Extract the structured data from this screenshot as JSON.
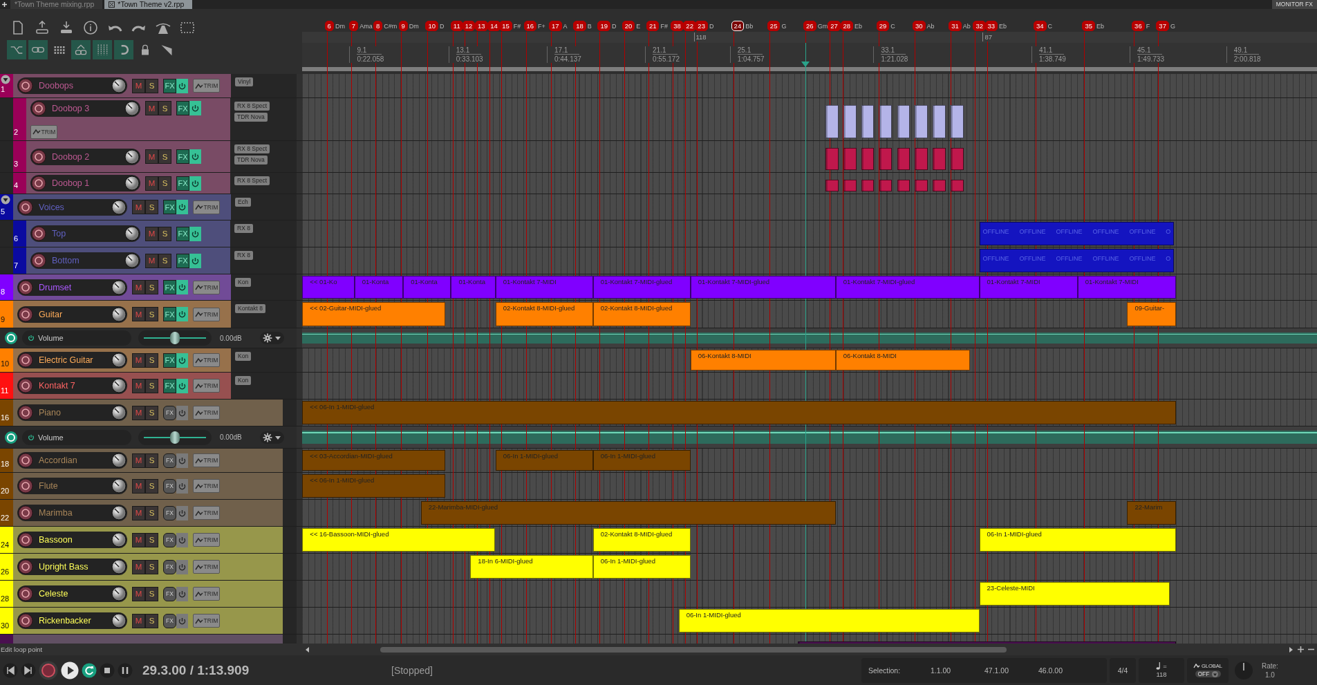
{
  "tabs": [
    {
      "label": "*Town Theme mixing.rpp",
      "selected": false
    },
    {
      "label": "*Town Theme v2.rpp",
      "selected": true
    }
  ],
  "monitor_fx": "MONITOR FX",
  "toolbar": [
    [
      {
        "kind": "new-file"
      },
      {
        "kind": "save-up"
      },
      {
        "kind": "save-down"
      },
      {
        "kind": "info"
      },
      {
        "kind": "undo"
      },
      {
        "kind": "redo"
      },
      {
        "kind": "metronome"
      },
      {
        "kind": "marquee"
      }
    ],
    [
      {
        "kind": "crossfade",
        "on": true
      },
      {
        "kind": "link",
        "on": true
      },
      {
        "kind": "grid",
        "on": false
      },
      {
        "kind": "env-link",
        "on": true
      },
      {
        "kind": "grid-lines",
        "on": true
      },
      {
        "kind": "snap",
        "on": true
      },
      {
        "kind": "lock",
        "on": false
      },
      {
        "kind": "ruler",
        "on": false
      }
    ]
  ],
  "markers": [
    {
      "number": "6",
      "label": "Dm",
      "selected": false
    },
    {
      "number": "7",
      "label": "Ama",
      "selected": false
    },
    {
      "number": "8",
      "label": "C#m",
      "selected": false
    },
    {
      "number": "9",
      "label": "Dm",
      "selected": false
    },
    {
      "number": "10",
      "label": "D",
      "selected": false
    },
    {
      "number": "11",
      "selected": false
    },
    {
      "number": "12",
      "selected": false
    },
    {
      "number": "13",
      "selected": false
    },
    {
      "number": "14",
      "selected": false
    },
    {
      "number": "15",
      "label": "F#",
      "selected": false
    },
    {
      "number": "16",
      "label": "F+",
      "selected": false
    },
    {
      "number": "17",
      "label": "A",
      "selected": false
    },
    {
      "number": "18",
      "label": "B",
      "selected": false
    },
    {
      "number": "19",
      "label": "D",
      "selected": false
    },
    {
      "number": "20",
      "label": "E",
      "selected": false
    },
    {
      "number": "21",
      "label": "F#",
      "selected": false
    },
    {
      "number": "38",
      "selected": false
    },
    {
      "number": "22",
      "selected": false
    },
    {
      "number": "23",
      "label": "D",
      "selected": false
    },
    {
      "number": "24",
      "label": "Bb",
      "selected": true
    },
    {
      "number": "25",
      "label": "G",
      "selected": false
    },
    {
      "number": "26",
      "label": "Gm",
      "selected": false
    },
    {
      "number": "27",
      "selected": false
    },
    {
      "number": "28",
      "label": "Eb",
      "selected": false
    },
    {
      "number": "29",
      "label": "C",
      "selected": false
    },
    {
      "number": "30",
      "label": "Ab",
      "selected": false
    },
    {
      "number": "31",
      "label": "Ab",
      "selected": false
    },
    {
      "number": "32",
      "selected": false
    },
    {
      "number": "33",
      "label": "Eb",
      "selected": false
    },
    {
      "number": "34",
      "label": "C",
      "selected": false
    },
    {
      "number": "35",
      "label": "Eb",
      "selected": false
    },
    {
      "number": "36",
      "label": "F",
      "selected": false
    },
    {
      "number": "37",
      "label": "G",
      "selected": false
    }
  ],
  "tempo_markers": [
    "118",
    "87"
  ],
  "ruler": [
    {
      "bar": "9.1",
      "time": "0:22.058"
    },
    {
      "bar": "13.1",
      "time": "0:33.103"
    },
    {
      "bar": "17.1",
      "time": "0:44.137"
    },
    {
      "bar": "21.1",
      "time": "0:55.172"
    },
    {
      "bar": "25.1",
      "time": "1:04.757"
    },
    {
      "bar": "33.1",
      "time": "1:21.028"
    },
    {
      "bar": "41.1",
      "time": "1:38.749"
    },
    {
      "bar": "45.1",
      "time": "1:49.733"
    },
    {
      "bar": "49.1",
      "time": "2:00.818"
    }
  ],
  "tracks": [
    {
      "kind": "track",
      "number": "1",
      "name": "Doobops",
      "color": "#9a0058",
      "expanded": true,
      "mute_label": "M",
      "solo_label": "S",
      "fx_label": "FX",
      "fx_on": true,
      "trim_label": "TRIM",
      "plugins": [
        "Vinyl"
      ],
      "children": [
        {
          "kind": "track",
          "number": "2",
          "name": "Doobop 3",
          "color": "#9a0058",
          "mute_label": "M",
          "solo_label": "S",
          "fx_label": "FX",
          "fx_on": true,
          "trim_label": "TRIM",
          "plugins": [
            "RX 8 Spect",
            "TDR Nova"
          ],
          "clips": [
            {
              "kind": "audio",
              "color": "#b4b4e8"
            },
            {
              "kind": "audio",
              "color": "#b4b4e8"
            },
            {
              "kind": "audio",
              "color": "#b4b4e8"
            },
            {
              "kind": "audio",
              "color": "#b4b4e8"
            },
            {
              "kind": "audio",
              "color": "#b4b4e8"
            },
            {
              "kind": "audio",
              "color": "#b4b4e8"
            },
            {
              "kind": "audio",
              "color": "#b4b4e8"
            },
            {
              "kind": "audio",
              "color": "#b4b4e8"
            }
          ]
        },
        {
          "kind": "track",
          "number": "3",
          "name": "Doobop 2",
          "color": "#9a0058",
          "mute_label": "M",
          "solo_label": "S",
          "fx_label": "FX",
          "fx_on": true,
          "plugins": [
            "RX 8 Spect",
            "TDR Nova"
          ],
          "clips": [
            {
              "kind": "audio",
              "color": "#c0184c"
            },
            {
              "kind": "audio",
              "color": "#c0184c"
            },
            {
              "kind": "audio",
              "color": "#c0184c"
            },
            {
              "kind": "audio",
              "color": "#c0184c"
            },
            {
              "kind": "audio",
              "color": "#c0184c"
            },
            {
              "kind": "audio",
              "color": "#c0184c"
            },
            {
              "kind": "audio",
              "color": "#c0184c"
            },
            {
              "kind": "audio",
              "color": "#c0184c"
            }
          ]
        },
        {
          "kind": "track",
          "number": "4",
          "name": "Doobop 1",
          "color": "#9a0058",
          "mute_label": "M",
          "solo_label": "S",
          "fx_label": "FX",
          "fx_on": true,
          "plugins": [
            "RX 8 Spect"
          ],
          "clips": [
            {
              "kind": "audio",
              "color": "#c0184c"
            },
            {
              "kind": "audio",
              "color": "#c0184c"
            },
            {
              "kind": "audio",
              "color": "#c0184c"
            },
            {
              "kind": "audio",
              "color": "#c0184c"
            },
            {
              "kind": "audio",
              "color": "#c0184c"
            },
            {
              "kind": "audio",
              "color": "#c0184c"
            },
            {
              "kind": "audio",
              "color": "#c0184c"
            },
            {
              "kind": "audio",
              "color": "#c0184c"
            }
          ]
        }
      ]
    },
    {
      "kind": "track",
      "number": "5",
      "name": "Voices",
      "color": "#0a0aa0",
      "expanded": true,
      "mute_label": "M",
      "solo_label": "S",
      "fx_label": "FX",
      "fx_on": true,
      "trim_label": "TRIM",
      "plugins": [
        "Ech"
      ],
      "children": [
        {
          "kind": "track",
          "number": "6",
          "name": "Top",
          "color": "#0a0aa0",
          "mute_label": "M",
          "solo_label": "S",
          "fx_label": "FX",
          "fx_on": true,
          "plugins": [
            "RX 8"
          ],
          "clips": [
            {
              "kind": "offline",
              "labels": [
                "OFFLINE",
                "OFFLINE",
                "OFFLINE",
                "OFFLINE",
                "OFFLINE",
                "O"
              ]
            }
          ]
        },
        {
          "kind": "track",
          "number": "7",
          "name": "Bottom",
          "color": "#0a0aa0",
          "mute_label": "M",
          "solo_label": "S",
          "fx_label": "FX",
          "fx_on": true,
          "plugins": [
            "RX 8"
          ],
          "clips": [
            {
              "kind": "offline",
              "labels": [
                "OFFLINE",
                "OFFLINE",
                "OFFLINE",
                "OFFLINE",
                "OFFLINE",
                "O"
              ]
            }
          ]
        }
      ]
    },
    {
      "kind": "track",
      "number": "8",
      "name": "Drumset",
      "color": "#8000ff",
      "mute_label": "M",
      "solo_label": "S",
      "fx_label": "FX",
      "fx_on": true,
      "trim_label": "TRIM",
      "plugins": [
        "Kon"
      ],
      "clips": [
        {
          "kind": "midi",
          "label": "<< 01-Ko"
        },
        {
          "kind": "midi",
          "label": "01-Konta"
        },
        {
          "kind": "midi",
          "label": "01-Konta"
        },
        {
          "kind": "midi",
          "label": "01-Konta"
        },
        {
          "kind": "midi",
          "label": "01-Kontakt 7-MIDI"
        },
        {
          "kind": "midi",
          "label": "01-Kontakt 7-MIDI-glued"
        },
        {
          "kind": "midi",
          "label": "01-Kontakt 7-MIDI-glued"
        },
        {
          "kind": "midi",
          "label": "01-Kontakt 7-MIDI-glued"
        },
        {
          "kind": "midi",
          "label": "01-Kontakt 7-MIDI"
        },
        {
          "kind": "midi",
          "label": "01-Kontakt 7-MIDI"
        }
      ]
    },
    {
      "kind": "track",
      "number": "9",
      "name": "Guitar",
      "color": "#ff8000",
      "mute_label": "M",
      "solo_label": "S",
      "fx_label": "FX",
      "fx_on": true,
      "trim_label": "TRIM",
      "plugins": [
        "Kontakt 8"
      ],
      "clips": [
        {
          "kind": "midi",
          "label": "<< 02-Guitar-MIDI-glued"
        },
        {
          "kind": "midi",
          "label": "02-Kontakt 8-MIDI-glued"
        },
        {
          "kind": "midi",
          "label": "02-Kontakt 8-MIDI-glued"
        },
        {
          "kind": "midi",
          "label": "09-Guitar-"
        }
      ]
    },
    {
      "kind": "envelope",
      "name": "Volume",
      "value": "0.00dB",
      "level": 0.5
    },
    {
      "kind": "track",
      "number": "10",
      "name": "Electric Guitar",
      "color": "#ff8000",
      "mute_label": "M",
      "solo_label": "S",
      "fx_label": "FX",
      "fx_on": true,
      "trim_label": "TRIM",
      "plugins": [
        "Kon"
      ],
      "clips": [
        {
          "kind": "midi",
          "label": "06-Kontakt 8-MIDI"
        },
        {
          "kind": "midi",
          "label": "06-Kontakt 8-MIDI"
        }
      ]
    },
    {
      "kind": "track",
      "number": "11",
      "name": "Kontakt 7",
      "color": "#ff1010",
      "mute_label": "M",
      "solo_label": "S",
      "fx_label": "FX",
      "fx_on": true,
      "trim_label": "TRIM",
      "plugins": [
        "Kon"
      ]
    },
    {
      "kind": "track",
      "number": "16",
      "name": "Piano",
      "color": "#7a4500",
      "mute_label": "M",
      "solo_label": "S",
      "fx_label": "FX",
      "fx_on": false,
      "trim_label": "TRIM",
      "clips": [
        {
          "kind": "midi",
          "label": "<< 06-In 1-MIDI-glued"
        }
      ]
    },
    {
      "kind": "envelope",
      "name": "Volume",
      "value": "0.00dB",
      "level": 0.5
    },
    {
      "kind": "track",
      "number": "18",
      "name": "Accordian",
      "color": "#7a4500",
      "mute_label": "M",
      "solo_label": "S",
      "fx_label": "FX",
      "fx_on": false,
      "trim_label": "TRIM",
      "clips": [
        {
          "kind": "midi",
          "label": "<< 03-Accordian-MIDI-glued"
        },
        {
          "kind": "midi",
          "label": "06-In 1-MIDI-glued"
        },
        {
          "kind": "midi",
          "label": "06-In 1-MIDI-glued"
        }
      ]
    },
    {
      "kind": "track",
      "number": "20",
      "name": "Flute",
      "color": "#7a4500",
      "mute_label": "M",
      "solo_label": "S",
      "fx_label": "FX",
      "fx_on": false,
      "trim_label": "TRIM",
      "clips": [
        {
          "kind": "midi",
          "label": "<< 06-In 1-MIDI-glued"
        }
      ]
    },
    {
      "kind": "track",
      "number": "22",
      "name": "Marimba",
      "color": "#7a4500",
      "mute_label": "M",
      "solo_label": "S",
      "fx_label": "FX",
      "fx_on": false,
      "trim_label": "TRIM",
      "clips": [
        {
          "kind": "midi",
          "label": "22-Marimba-MIDI-glued"
        },
        {
          "kind": "midi",
          "label": "22-Marim"
        }
      ]
    },
    {
      "kind": "track",
      "number": "24",
      "name": "Bassoon",
      "color": "#ffff00",
      "mute_label": "M",
      "solo_label": "S",
      "fx_label": "FX",
      "fx_on": false,
      "trim_label": "TRIM",
      "clips": [
        {
          "kind": "midi",
          "label": "<< 16-Bassoon-MIDI-glued"
        },
        {
          "kind": "midi",
          "label": "02-Kontakt 8-MIDI-glued"
        },
        {
          "kind": "midi",
          "label": "06-In 1-MIDI-glued"
        }
      ]
    },
    {
      "kind": "track",
      "number": "26",
      "name": "Upright Bass",
      "color": "#ffff00",
      "mute_label": "M",
      "solo_label": "S",
      "fx_label": "FX",
      "fx_on": false,
      "trim_label": "TRIM",
      "clips": [
        {
          "kind": "midi",
          "label": "18-In 6-MIDI-glued"
        },
        {
          "kind": "midi",
          "label": "06-In 1-MIDI-glued"
        }
      ]
    },
    {
      "kind": "track",
      "number": "28",
      "name": "Celeste",
      "color": "#ffff00",
      "mute_label": "M",
      "solo_label": "S",
      "fx_label": "FX",
      "fx_on": false,
      "trim_label": "TRIM",
      "clips": [
        {
          "kind": "midi",
          "label": "23-Celeste-MIDI"
        }
      ]
    },
    {
      "kind": "track",
      "number": "30",
      "name": "Rickenbacker",
      "color": "#ffff00",
      "mute_label": "M",
      "solo_label": "S",
      "fx_label": "FX",
      "fx_on": false,
      "trim_label": "TRIM",
      "clips": [
        {
          "kind": "midi",
          "label": "06-In 1-MIDI-glued"
        }
      ]
    },
    {
      "kind": "partial",
      "color": "#4a1050",
      "clips": [
        {
          "kind": "audio"
        }
      ]
    }
  ],
  "status": "Edit loop point",
  "transport": {
    "position": "29.3.00 / 1:13.909",
    "state": "[Stopped]",
    "repeat": true
  },
  "selection": {
    "label": "Selection:",
    "start": "1.1.00",
    "end": "47.1.00",
    "length": "46.0.00"
  },
  "time_signature": "4/4",
  "tempo": {
    "label": "=",
    "value": "118"
  },
  "global": {
    "label": "GLOBAL",
    "value": "OFF"
  },
  "rate": {
    "label": "Rate:",
    "value": "1.0"
  }
}
